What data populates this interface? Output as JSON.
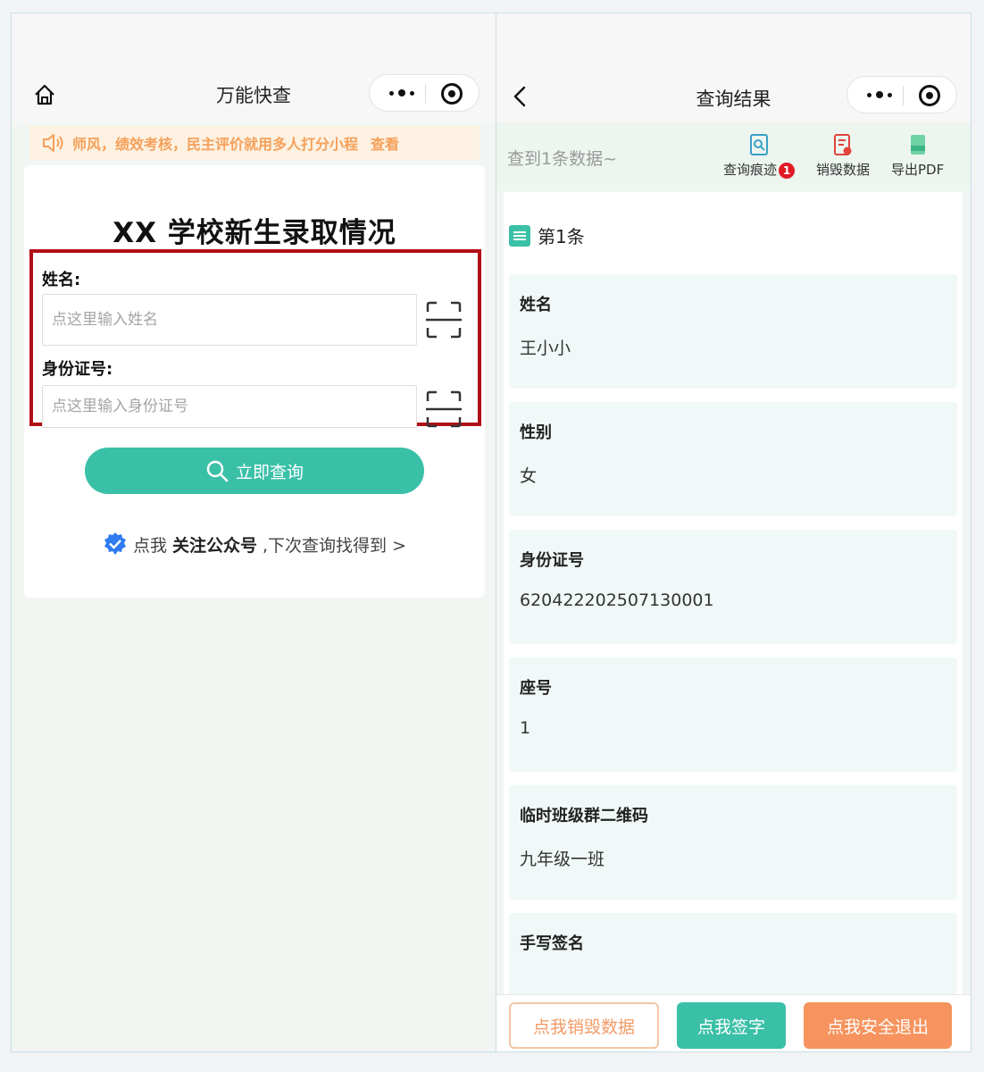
{
  "left": {
    "nav": {
      "title": "万能快查",
      "home_icon": "home-icon",
      "more_icon": "more-dots-icon",
      "close_icon": "target-icon"
    },
    "notice": {
      "text": "师风，绩效考核，民主评价就用多人打分小程",
      "link": "查看"
    },
    "form": {
      "title": "XX 学校新生录取情况",
      "name_label": "姓名:",
      "name_placeholder": "点这里输入姓名",
      "id_label": "身份证号:",
      "id_placeholder": "点这里输入身份证号",
      "query_button": "立即查询",
      "follow_prefix": "点我",
      "follow_bold": "关注公众号",
      "follow_suffix": ",下次查询找得到 >"
    }
  },
  "right": {
    "nav": {
      "title": "查询结果"
    },
    "found_text": "查到1条数据~",
    "tools": {
      "trace": "查询痕迹",
      "trace_badge": "1",
      "destroy": "销毁数据",
      "export": "导出PDF"
    },
    "record_title": "第1条",
    "fields": [
      {
        "label": "姓名",
        "value": "王小小"
      },
      {
        "label": "性别",
        "value": "女"
      },
      {
        "label": "身份证号",
        "value": "620422202507130001"
      },
      {
        "label": "座号",
        "value": "1"
      },
      {
        "label": "临时班级群二维码",
        "value": "九年级一班"
      },
      {
        "label": "手写签名",
        "value": ""
      }
    ],
    "footer": {
      "destroy": "点我销毁数据",
      "sign": "点我签字",
      "exit": "点我安全退出"
    }
  },
  "colors": {
    "accent": "#3bc0a8",
    "warning": "#f6935e",
    "highlight_border": "#b10f18",
    "notice_text": "#f5a05a"
  }
}
